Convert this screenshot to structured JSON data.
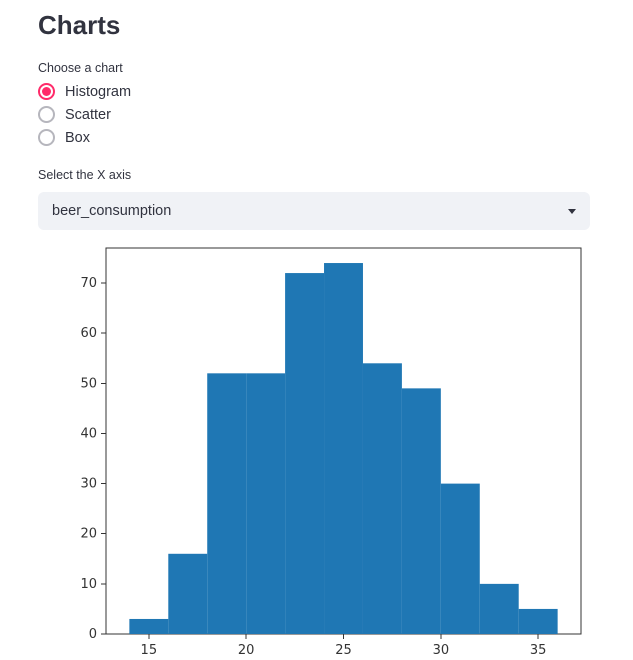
{
  "header": {
    "title": "Charts"
  },
  "radio": {
    "label": "Choose a chart",
    "options": [
      {
        "label": "Histogram",
        "selected": true
      },
      {
        "label": "Scatter",
        "selected": false
      },
      {
        "label": "Box",
        "selected": false
      }
    ]
  },
  "x_axis_select": {
    "label": "Select the X axis",
    "value": "beer_consumption"
  },
  "chart_data": {
    "type": "bar",
    "bin_edges": [
      14,
      16,
      18,
      20,
      22,
      24,
      26,
      28,
      30,
      32,
      34,
      36
    ],
    "values": [
      3,
      16,
      52,
      52,
      72,
      74,
      54,
      49,
      30,
      10,
      5
    ],
    "xticks": [
      15,
      20,
      25,
      30,
      35
    ],
    "yticks": [
      0,
      10,
      20,
      30,
      40,
      50,
      60,
      70
    ],
    "ylim": [
      0,
      77
    ],
    "xlim": [
      12.8,
      37.2
    ]
  }
}
